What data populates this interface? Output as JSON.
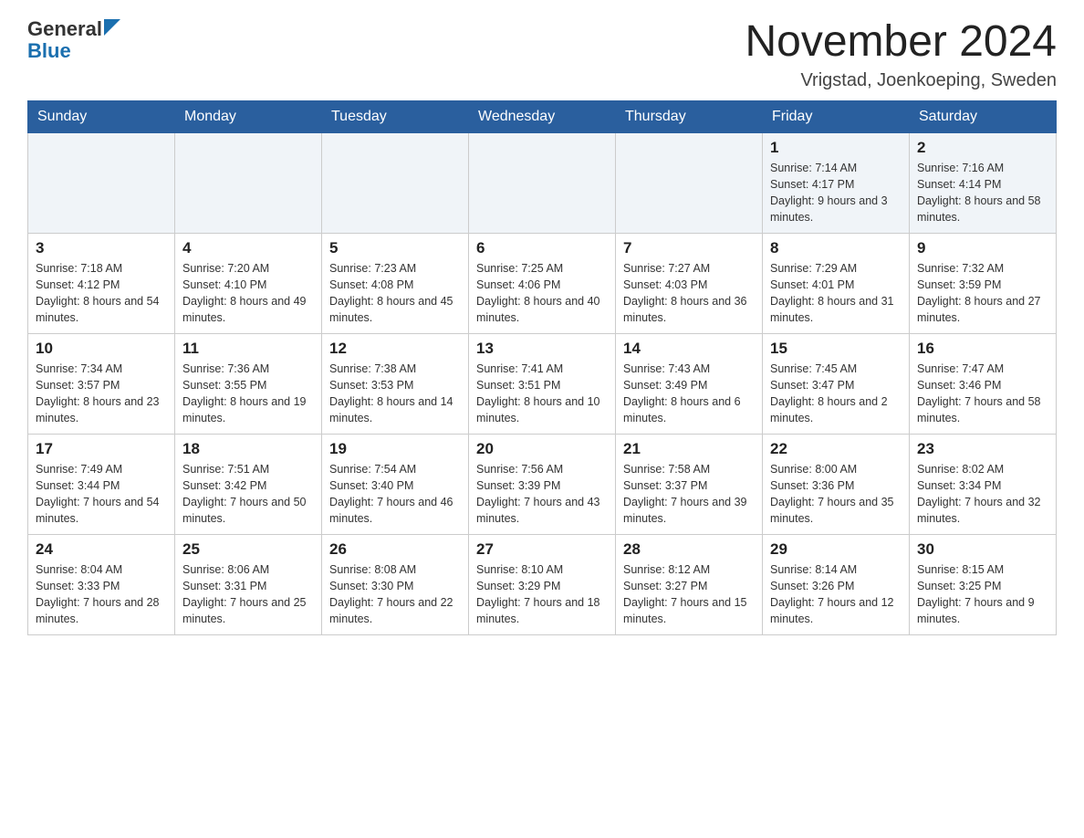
{
  "header": {
    "month_year": "November 2024",
    "location": "Vrigstad, Joenkoeping, Sweden",
    "logo_general": "General",
    "logo_blue": "Blue"
  },
  "days_of_week": [
    "Sunday",
    "Monday",
    "Tuesday",
    "Wednesday",
    "Thursday",
    "Friday",
    "Saturday"
  ],
  "weeks": [
    [
      {
        "day": "",
        "info": ""
      },
      {
        "day": "",
        "info": ""
      },
      {
        "day": "",
        "info": ""
      },
      {
        "day": "",
        "info": ""
      },
      {
        "day": "",
        "info": ""
      },
      {
        "day": "1",
        "info": "Sunrise: 7:14 AM\nSunset: 4:17 PM\nDaylight: 9 hours and 3 minutes."
      },
      {
        "day": "2",
        "info": "Sunrise: 7:16 AM\nSunset: 4:14 PM\nDaylight: 8 hours and 58 minutes."
      }
    ],
    [
      {
        "day": "3",
        "info": "Sunrise: 7:18 AM\nSunset: 4:12 PM\nDaylight: 8 hours and 54 minutes."
      },
      {
        "day": "4",
        "info": "Sunrise: 7:20 AM\nSunset: 4:10 PM\nDaylight: 8 hours and 49 minutes."
      },
      {
        "day": "5",
        "info": "Sunrise: 7:23 AM\nSunset: 4:08 PM\nDaylight: 8 hours and 45 minutes."
      },
      {
        "day": "6",
        "info": "Sunrise: 7:25 AM\nSunset: 4:06 PM\nDaylight: 8 hours and 40 minutes."
      },
      {
        "day": "7",
        "info": "Sunrise: 7:27 AM\nSunset: 4:03 PM\nDaylight: 8 hours and 36 minutes."
      },
      {
        "day": "8",
        "info": "Sunrise: 7:29 AM\nSunset: 4:01 PM\nDaylight: 8 hours and 31 minutes."
      },
      {
        "day": "9",
        "info": "Sunrise: 7:32 AM\nSunset: 3:59 PM\nDaylight: 8 hours and 27 minutes."
      }
    ],
    [
      {
        "day": "10",
        "info": "Sunrise: 7:34 AM\nSunset: 3:57 PM\nDaylight: 8 hours and 23 minutes."
      },
      {
        "day": "11",
        "info": "Sunrise: 7:36 AM\nSunset: 3:55 PM\nDaylight: 8 hours and 19 minutes."
      },
      {
        "day": "12",
        "info": "Sunrise: 7:38 AM\nSunset: 3:53 PM\nDaylight: 8 hours and 14 minutes."
      },
      {
        "day": "13",
        "info": "Sunrise: 7:41 AM\nSunset: 3:51 PM\nDaylight: 8 hours and 10 minutes."
      },
      {
        "day": "14",
        "info": "Sunrise: 7:43 AM\nSunset: 3:49 PM\nDaylight: 8 hours and 6 minutes."
      },
      {
        "day": "15",
        "info": "Sunrise: 7:45 AM\nSunset: 3:47 PM\nDaylight: 8 hours and 2 minutes."
      },
      {
        "day": "16",
        "info": "Sunrise: 7:47 AM\nSunset: 3:46 PM\nDaylight: 7 hours and 58 minutes."
      }
    ],
    [
      {
        "day": "17",
        "info": "Sunrise: 7:49 AM\nSunset: 3:44 PM\nDaylight: 7 hours and 54 minutes."
      },
      {
        "day": "18",
        "info": "Sunrise: 7:51 AM\nSunset: 3:42 PM\nDaylight: 7 hours and 50 minutes."
      },
      {
        "day": "19",
        "info": "Sunrise: 7:54 AM\nSunset: 3:40 PM\nDaylight: 7 hours and 46 minutes."
      },
      {
        "day": "20",
        "info": "Sunrise: 7:56 AM\nSunset: 3:39 PM\nDaylight: 7 hours and 43 minutes."
      },
      {
        "day": "21",
        "info": "Sunrise: 7:58 AM\nSunset: 3:37 PM\nDaylight: 7 hours and 39 minutes."
      },
      {
        "day": "22",
        "info": "Sunrise: 8:00 AM\nSunset: 3:36 PM\nDaylight: 7 hours and 35 minutes."
      },
      {
        "day": "23",
        "info": "Sunrise: 8:02 AM\nSunset: 3:34 PM\nDaylight: 7 hours and 32 minutes."
      }
    ],
    [
      {
        "day": "24",
        "info": "Sunrise: 8:04 AM\nSunset: 3:33 PM\nDaylight: 7 hours and 28 minutes."
      },
      {
        "day": "25",
        "info": "Sunrise: 8:06 AM\nSunset: 3:31 PM\nDaylight: 7 hours and 25 minutes."
      },
      {
        "day": "26",
        "info": "Sunrise: 8:08 AM\nSunset: 3:30 PM\nDaylight: 7 hours and 22 minutes."
      },
      {
        "day": "27",
        "info": "Sunrise: 8:10 AM\nSunset: 3:29 PM\nDaylight: 7 hours and 18 minutes."
      },
      {
        "day": "28",
        "info": "Sunrise: 8:12 AM\nSunset: 3:27 PM\nDaylight: 7 hours and 15 minutes."
      },
      {
        "day": "29",
        "info": "Sunrise: 8:14 AM\nSunset: 3:26 PM\nDaylight: 7 hours and 12 minutes."
      },
      {
        "day": "30",
        "info": "Sunrise: 8:15 AM\nSunset: 3:25 PM\nDaylight: 7 hours and 9 minutes."
      }
    ]
  ]
}
